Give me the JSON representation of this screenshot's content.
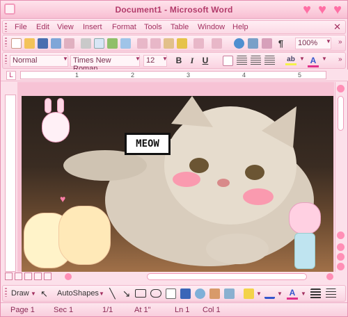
{
  "window": {
    "title": "Document1 - Microsoft Word"
  },
  "menubar": {
    "items": [
      "File",
      "Edit",
      "View",
      "Insert",
      "Format",
      "Tools",
      "Table",
      "Window",
      "Help"
    ]
  },
  "toolbar": {
    "zoom": "100%"
  },
  "formatting": {
    "style": "Normal",
    "font": "Times New Roman",
    "size": "12",
    "bold": "B",
    "italic": "I",
    "underline": "U",
    "highlight_letter": "ab",
    "font_color_letter": "A"
  },
  "ruler": {
    "numbers": [
      "1",
      "2",
      "3",
      "4",
      "5"
    ]
  },
  "sticker": {
    "speech": "MEOW"
  },
  "drawbar": {
    "draw_label": "Draw",
    "autoshapes_label": "AutoShapes"
  },
  "status": {
    "page": "Page 1",
    "sec": "Sec 1",
    "pos": "1/1",
    "at": "At 1\"",
    "ln": "Ln 1",
    "col": "Col 1"
  },
  "colors": {
    "accent": "#ff6fa5",
    "menu_text": "#a23060",
    "title_text": "#b23a6a"
  }
}
